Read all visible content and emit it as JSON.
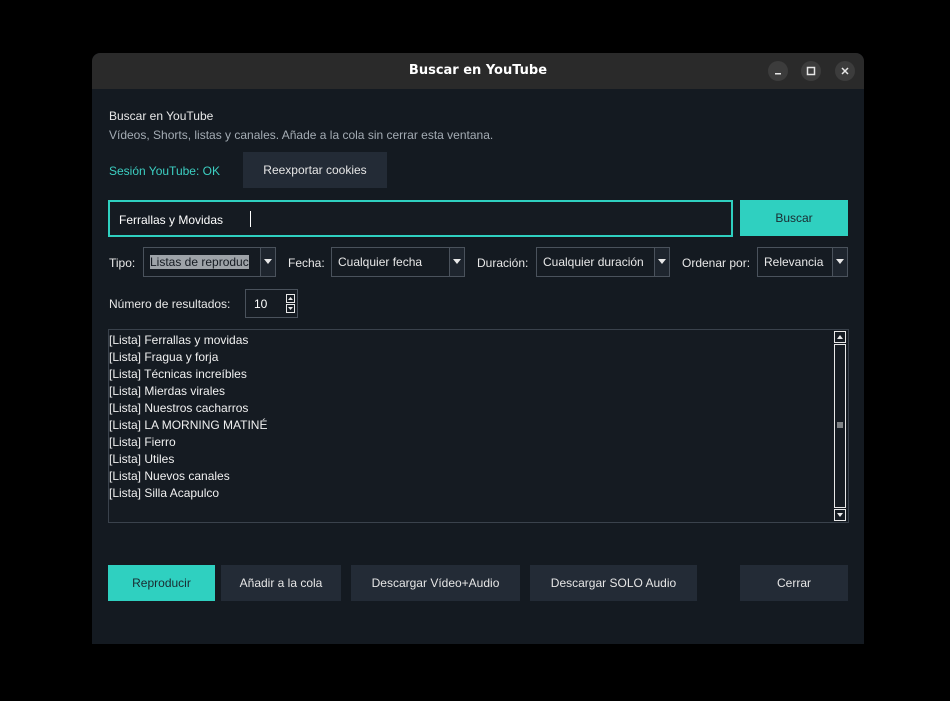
{
  "window": {
    "title": "Buscar en YouTube",
    "controls": [
      "minimize-icon",
      "maximize-icon",
      "close-icon"
    ]
  },
  "header": {
    "title": "Buscar en YouTube",
    "subtitle": "Vídeos, Shorts, listas y canales. Añade a la cola sin cerrar esta ventana."
  },
  "session": {
    "status": "Sesión YouTube: OK",
    "reexport_label": "Reexportar cookies"
  },
  "search": {
    "value": "Ferrallas y Movidas",
    "button_label": "Buscar"
  },
  "filters": {
    "tipo_label": "Tipo:",
    "tipo_value": "Listas de reproduc",
    "fecha_label": "Fecha:",
    "fecha_value": "Cualquier fecha",
    "duracion_label": "Duración:",
    "duracion_value": "Cualquier duración",
    "orden_label": "Ordenar por:",
    "orden_value": "Relevancia"
  },
  "results_count": {
    "label": "Número de resultados:",
    "value": "10"
  },
  "results": [
    "[Lista] Ferrallas y movidas",
    "[Lista] Fragua y forja",
    "[Lista] Técnicas increíbles",
    "[Lista] Mierdas virales",
    "[Lista] Nuestros cacharros",
    "[Lista] LA MORNING MATINÉ",
    "[Lista] Fierro",
    "[Lista] Utiles",
    "[Lista] Nuevos canales",
    "[Lista] Silla Acapulco"
  ],
  "actions": {
    "play": "Reproducir",
    "queue": "Añadir a la cola",
    "download_video": "Descargar Vídeo+Audio",
    "download_audio": "Descargar SOLO Audio",
    "close": "Cerrar"
  },
  "colors": {
    "accent": "#2fd0c0",
    "background": "#141a21",
    "button": "#232b36"
  }
}
